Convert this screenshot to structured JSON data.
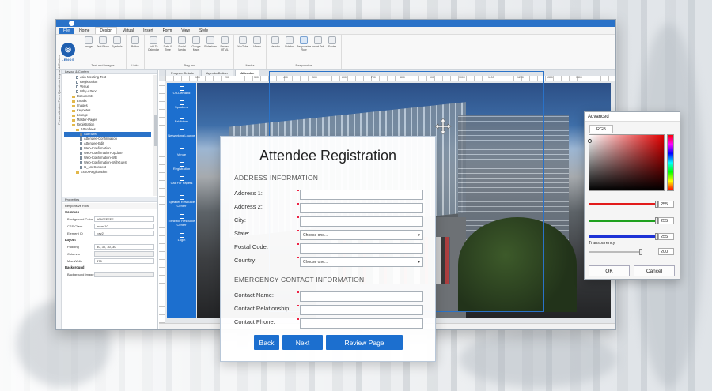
{
  "menubar": {
    "file": "File",
    "items": [
      "Home",
      "Design",
      "Virtual",
      "Insert",
      "Form",
      "View",
      "Style"
    ]
  },
  "brand": {
    "logo_text": "LENOS"
  },
  "ribbon": {
    "groups": [
      {
        "name": "Text and Images",
        "items": [
          "Image",
          "Text Block",
          "Symbols"
        ]
      },
      {
        "name": "Links",
        "items": [
          "Button"
        ]
      },
      {
        "name": "Plug-ins",
        "items": [
          "Add To Calendar",
          "Date & Time",
          "Social Media",
          "Google Maps",
          "Slideshow",
          "Embed HTML"
        ]
      },
      {
        "name": "Media",
        "items": [
          "YouTube",
          "Vimeo"
        ]
      },
      {
        "name": "Responsive",
        "items": [
          "Header",
          "Sidebar",
          "Responsive Row",
          "Insert Tab",
          "Footer"
        ]
      }
    ]
  },
  "left": {
    "vtab": "Personalization  Form Questions  Layout & Content",
    "layout_header": "Layout & Content",
    "tree": [
      {
        "label": "Join-Meeting-Test",
        "type": "page",
        "indent": 3
      },
      {
        "label": "Registration",
        "type": "page",
        "indent": 3
      },
      {
        "label": "Venue",
        "type": "page",
        "indent": 3
      },
      {
        "label": "Why-Attend",
        "type": "page",
        "indent": 3
      },
      {
        "label": "Documents",
        "type": "folder",
        "indent": 2
      },
      {
        "label": "Emails",
        "type": "folder",
        "indent": 2
      },
      {
        "label": "Images",
        "type": "folder",
        "indent": 2
      },
      {
        "label": "Keynotes",
        "type": "folder",
        "indent": 2
      },
      {
        "label": "Lounge",
        "type": "folder",
        "indent": 2
      },
      {
        "label": "Master-Pages",
        "type": "folder",
        "indent": 2
      },
      {
        "label": "Registration",
        "type": "folder",
        "indent": 2
      },
      {
        "label": "Attendees",
        "type": "folder",
        "indent": 3
      },
      {
        "label": "Attendee",
        "type": "page",
        "indent": 4,
        "selected": true
      },
      {
        "label": "Attendee-Confirmation",
        "type": "page",
        "indent": 4
      },
      {
        "label": "Attendee-Edit",
        "type": "page",
        "indent": 4
      },
      {
        "label": "Web-Confirmation",
        "type": "page",
        "indent": 4
      },
      {
        "label": "Web-Confirmation-Update",
        "type": "page",
        "indent": 4
      },
      {
        "label": "Web-Confirmation-WB",
        "type": "page",
        "indent": 4
      },
      {
        "label": "Web-Confirmation-WithGuest",
        "type": "page",
        "indent": 4
      },
      {
        "label": "Is_No-Consent",
        "type": "page",
        "indent": 4
      },
      {
        "label": "Expo-Registration",
        "type": "folder",
        "indent": 3
      }
    ],
    "props_header": "Properties",
    "props_sub": "Responsive Row",
    "props": {
      "common": "Common",
      "bg_color_k": "Background Color",
      "bg_color_v": "#6A0FFFFF",
      "css_k": "CSS Class",
      "css_v": "bread10",
      "id_k": "Element ID",
      "id_v": "row2",
      "layout": "Layout",
      "padding_k": "Padding",
      "padding_v": "30, 30, 30, 30",
      "columns_k": "Columns",
      "columns_v": "",
      "maxw_k": "Max Width",
      "maxw_v": "875",
      "background": "Background",
      "bgimg_k": "Background Image",
      "bgimg_v": ""
    }
  },
  "doctabs": [
    "Program Details",
    "Agenda-Builder",
    "Attendee"
  ],
  "ruler_nums": [
    "100",
    "200",
    "300",
    "400",
    "500",
    "600",
    "700",
    "800",
    "900",
    "1000",
    "1100",
    "1200",
    "1300",
    "1400"
  ],
  "sidenav": [
    "On-Demand",
    "Speakers",
    "Exhibitors",
    "Networking Lounge",
    "Venue",
    "Registration",
    "Call For Papers",
    "Speaker Resource Center",
    "Exhibitor Resource Center",
    "Login"
  ],
  "form": {
    "title": "Attendee Registration",
    "address_section": "ADDRESS INFORMATION",
    "address1": "Address 1:",
    "address2": "Address 2:",
    "city": "City:",
    "state": "State:",
    "state_placeholder": "Choose one...",
    "postal": "Postal Code:",
    "country": "Country:",
    "country_placeholder": "Choose one...",
    "emergency_section": "EMERGENCY CONTACT INFORMATION",
    "contact_name": "Contact Name:",
    "contact_rel": "Contact Relationship:",
    "contact_phone": "Contact Phone:",
    "back": "Back",
    "next": "Next",
    "review": "Review Page"
  },
  "advanced": {
    "title": "Advanced",
    "tab": "RGB",
    "r": "255",
    "g": "255",
    "b": "255",
    "transparency_label": "Transparency",
    "transparency": "200",
    "ok": "OK",
    "cancel": "Cancel",
    "colors": {
      "red": "#e21b1b",
      "green": "#1fa11f",
      "blue": "#1f33d6"
    }
  }
}
